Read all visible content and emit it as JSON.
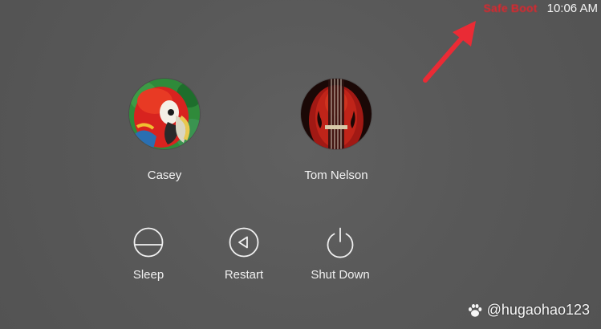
{
  "status_bar": {
    "mode_label": "Safe Boot",
    "time": "10:06 AM"
  },
  "users": [
    {
      "name": "Casey",
      "avatar": "parrot-icon"
    },
    {
      "name": "Tom Nelson",
      "avatar": "violin-icon"
    }
  ],
  "power_actions": [
    {
      "label": "Sleep",
      "icon": "sleep-icon"
    },
    {
      "label": "Restart",
      "icon": "restart-icon"
    },
    {
      "label": "Shut Down",
      "icon": "power-icon"
    }
  ],
  "watermark": {
    "text": "@hugaohao123"
  },
  "colors": {
    "background": "#585858",
    "safe_boot": "#e0262d",
    "annotation_arrow": "#ea2b35",
    "text": "#f3f3f3"
  }
}
